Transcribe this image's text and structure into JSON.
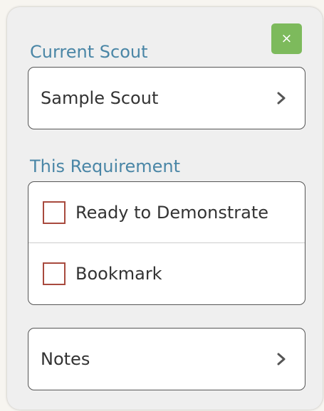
{
  "close_button": {
    "label": "×",
    "color": "#7dba5c"
  },
  "current_scout": {
    "heading": "Current Scout",
    "name": "Sample Scout",
    "icon": "chevron-right-icon"
  },
  "this_requirement": {
    "heading": "This Requirement",
    "options": [
      {
        "label": "Ready to Demonstrate",
        "checked": false
      },
      {
        "label": "Bookmark",
        "checked": false
      }
    ]
  },
  "notes": {
    "label": "Notes",
    "icon": "chevron-right-icon"
  },
  "colors": {
    "heading": "#4a86a6",
    "checkbox_border": "#a84a3e",
    "panel_bg": "#efefef"
  }
}
